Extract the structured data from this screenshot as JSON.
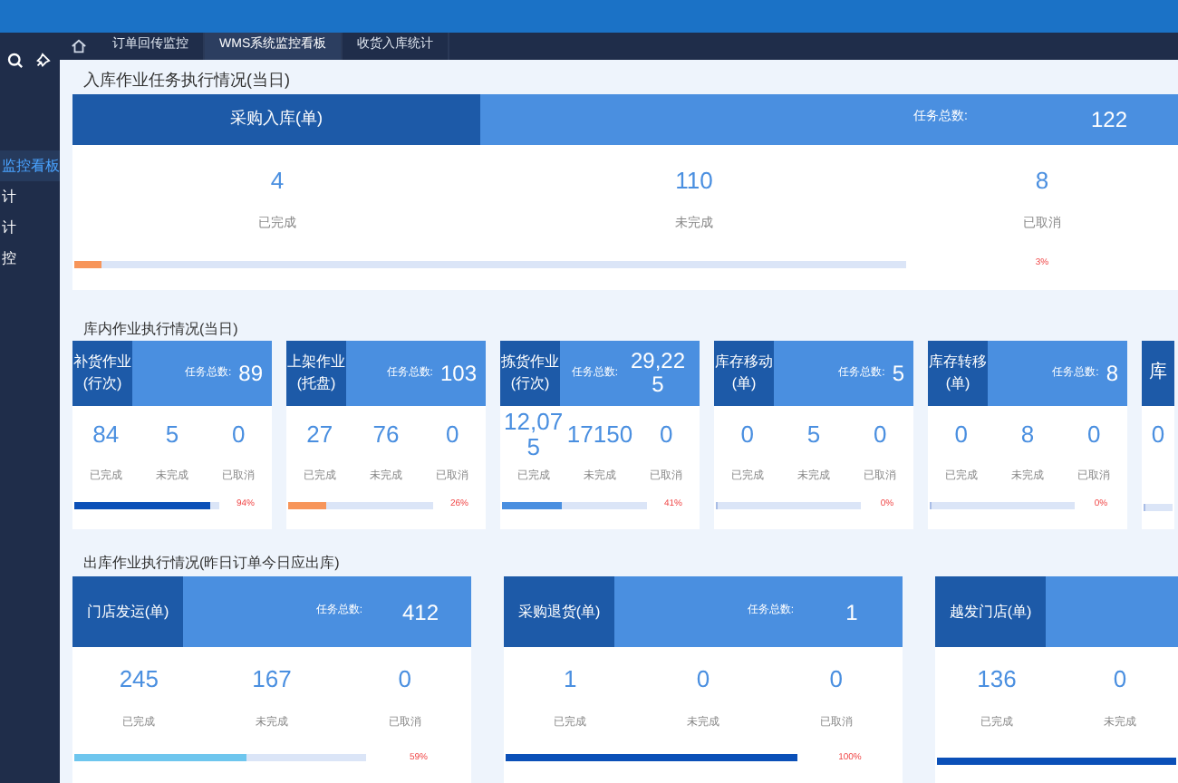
{
  "top_tabs": [
    {
      "label": "订单回传监控",
      "selected": false
    },
    {
      "label": "WMS系统监控看板",
      "selected": true
    },
    {
      "label": "收货入库统计",
      "selected": false
    }
  ],
  "sidebar": {
    "items": [
      {
        "label": "监控看板",
        "selected": true
      },
      {
        "label": "计",
        "selected": false
      },
      {
        "label": "计",
        "selected": false
      },
      {
        "label": "控",
        "selected": false
      }
    ]
  },
  "sections": [
    {
      "kind": "wide",
      "title": "入库作业任务执行情况(当日)",
      "cards": [
        {
          "name": "采购入库(单)",
          "total_label": "任务总数:",
          "total": "122",
          "stats": [
            {
              "value": "4",
              "label": "已完成"
            },
            {
              "value": "110",
              "label": "未完成"
            },
            {
              "value": "8",
              "label": "已取消"
            }
          ],
          "level": 0.033,
          "color": "#f7955a",
          "percent": "3%"
        }
      ]
    },
    {
      "kind": "small",
      "title": "库内作业执行情况(当日)",
      "cards": [
        {
          "name": "补货作业(行次)",
          "total_label": "任务总数:",
          "total": "89",
          "stats": [
            {
              "value": "84",
              "label": "已完成"
            },
            {
              "value": "5",
              "label": "未完成"
            },
            {
              "value": "0",
              "label": "已取消"
            }
          ],
          "level": 0.94,
          "color": "#0b50b8",
          "percent": "94%"
        },
        {
          "name": "上架作业(托盘)",
          "total_label": "任务总数:",
          "total": "103",
          "stats": [
            {
              "value": "27",
              "label": "已完成"
            },
            {
              "value": "76",
              "label": "未完成"
            },
            {
              "value": "0",
              "label": "已取消"
            }
          ],
          "level": 0.26,
          "color": "#f7955a",
          "percent": "26%"
        },
        {
          "name": "拣货作业(行次)",
          "total_label": "任务总数:",
          "total": "29,225",
          "stats": [
            {
              "value": "12,075",
              "label": "已完成"
            },
            {
              "value": "17150",
              "label": "未完成"
            },
            {
              "value": "0",
              "label": "已取消"
            }
          ],
          "level": 0.41,
          "color": "#4a8fe0",
          "percent": "41%"
        },
        {
          "name": "库存移动(单)",
          "total_label": "任务总数:",
          "total": "5",
          "stats": [
            {
              "value": "0",
              "label": "已完成"
            },
            {
              "value": "5",
              "label": "未完成"
            },
            {
              "value": "0",
              "label": "已取消"
            }
          ],
          "level": 0,
          "percent": "0%"
        },
        {
          "name": "库存转移(单)",
          "total_label": "任务总数:",
          "total": "8",
          "stats": [
            {
              "value": "0",
              "label": "已完成"
            },
            {
              "value": "8",
              "label": "未完成"
            },
            {
              "value": "0",
              "label": "已取消"
            }
          ],
          "level": 0,
          "percent": "0%"
        },
        {
          "name": "库",
          "stats": [
            {
              "value": "0"
            }
          ],
          "level": 0
        }
      ]
    },
    {
      "kind": "medium",
      "title": "出库作业执行情况(昨日订单今日应出库)",
      "cards": [
        {
          "name": "门店发运(单)",
          "total_label": "任务总数:",
          "total": "412",
          "stats": [
            {
              "value": "245",
              "label": "已完成"
            },
            {
              "value": "167",
              "label": "未完成"
            },
            {
              "value": "0",
              "label": "已取消"
            }
          ],
          "level": 0.59,
          "color": "#6ec6ee",
          "percent": "59%"
        },
        {
          "name": "采购退货(单)",
          "total_label": "任务总数:",
          "total": "1",
          "stats": [
            {
              "value": "1",
              "label": "已完成"
            },
            {
              "value": "0",
              "label": "未完成"
            },
            {
              "value": "0",
              "label": "已取消"
            }
          ],
          "level": 1,
          "color": "#0b50b8",
          "percent": "100%"
        },
        {
          "name": "越发门店(单)",
          "stats": [
            {
              "value": "136",
              "label": "已完成"
            },
            {
              "value": "0",
              "label": "未完成"
            }
          ],
          "level": 1,
          "color": "#0b50b8"
        }
      ]
    }
  ]
}
